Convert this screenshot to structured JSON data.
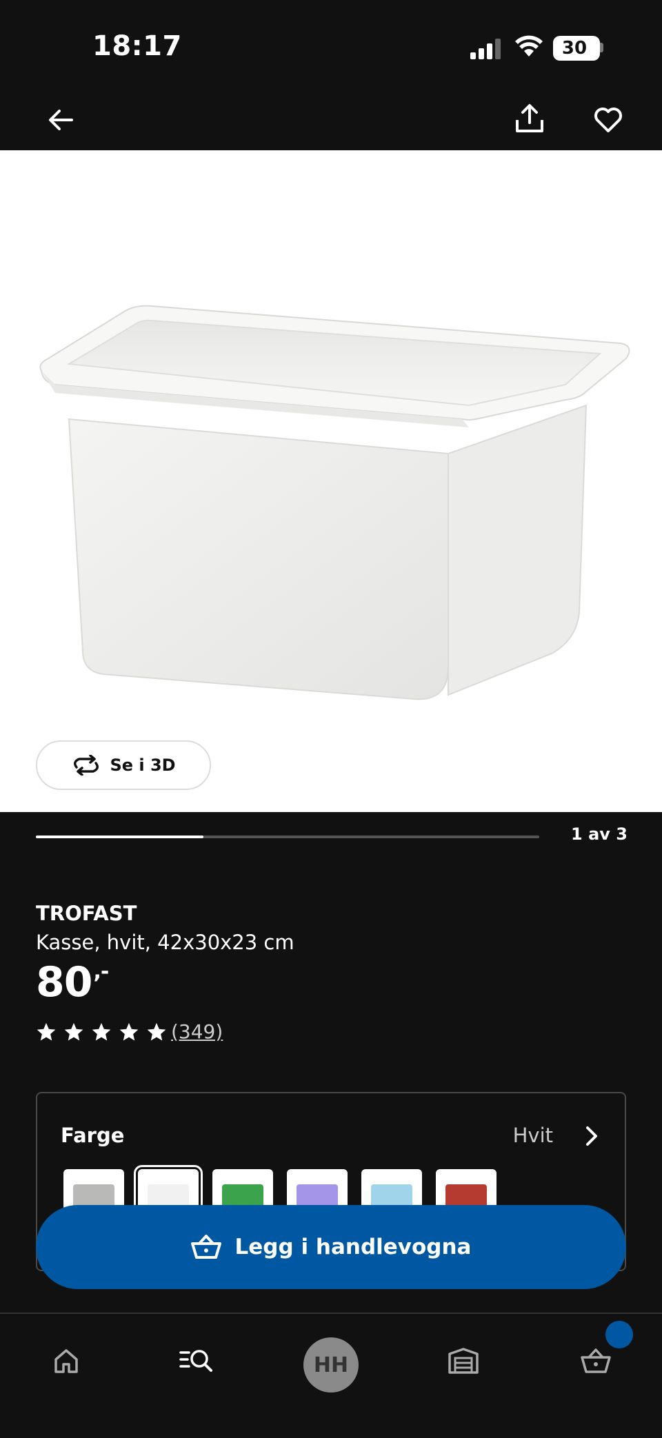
{
  "status_bar": {
    "time": "18:17",
    "battery": "30"
  },
  "top_nav": {
    "icons": [
      "back-arrow-icon",
      "share-icon",
      "heart-icon"
    ]
  },
  "media": {
    "view_3d_label": "Se i 3D",
    "carousel_position_text": "1 av 3",
    "carousel_index": 1,
    "carousel_total": 3
  },
  "product": {
    "name": "TROFAST",
    "description": "Kasse, hvit, 42x30x23 cm",
    "price_main": "80",
    "price_decimals": ",-",
    "rating": 5,
    "review_count": "(349)"
  },
  "color_selector": {
    "label": "Farge",
    "selected_value": "Hvit",
    "swatches": [
      {
        "name": "grey",
        "color": "#b9bab7",
        "selected": false
      },
      {
        "name": "white",
        "color": "#f1f1f1",
        "selected": true
      },
      {
        "name": "green",
        "color": "#3aa34b",
        "selected": false
      },
      {
        "name": "lilac",
        "color": "#a595e8",
        "selected": false
      },
      {
        "name": "light-blue",
        "color": "#9fd4ea",
        "selected": false
      },
      {
        "name": "red",
        "color": "#b53a30",
        "selected": false
      }
    ]
  },
  "cart_button": {
    "label": "Legg i handlevogna",
    "color": "#0058a3"
  },
  "bottom_nav": {
    "items": [
      "home-icon",
      "search-icon",
      "profile-avatar",
      "store-icon",
      "cart-icon"
    ],
    "avatar_initials": "HH",
    "cart_badge_color": "#0058a3"
  }
}
